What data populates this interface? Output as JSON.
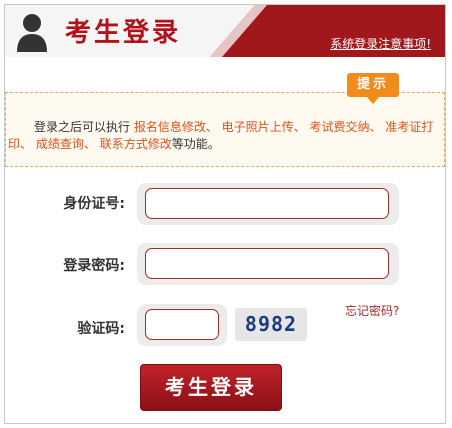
{
  "header": {
    "title": "考生登录",
    "notice_link": "系统登录注意事项!"
  },
  "tip": {
    "badge": "提示",
    "text_prefix": "登录之后可以执行 ",
    "links": [
      "报名信息修改、",
      "电子照片上传、",
      "考试费交纳、",
      "准考证打印、",
      "成绩查询、",
      "联系方式修改"
    ],
    "text_suffix": "等功能。"
  },
  "form": {
    "id_label": "身份证号:",
    "password_label": "登录密码:",
    "captcha_label": "验证码:",
    "captcha_code": "8982",
    "forgot_password": "忘记密码?",
    "login_button": "考生登录"
  },
  "colors": {
    "brand_red": "#a0181c",
    "tip_orange": "#f28a1c",
    "highlight": "#e0501c"
  }
}
